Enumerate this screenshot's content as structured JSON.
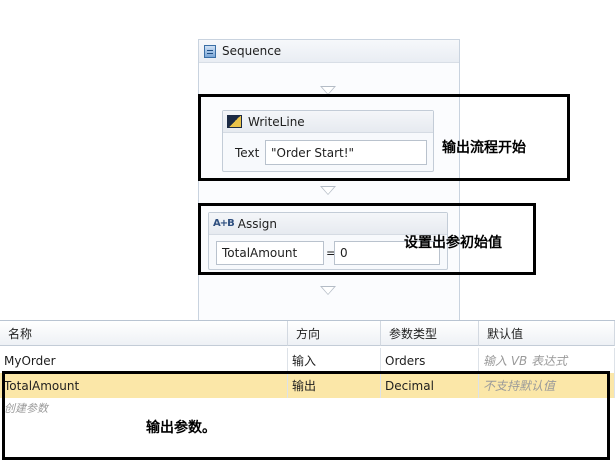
{
  "sequence": {
    "title": "Sequence"
  },
  "writeline": {
    "title": "WriteLine",
    "text_label": "Text",
    "text_value": "\"Order Start!\""
  },
  "assign": {
    "icon_text": "A+B",
    "title": "Assign",
    "to_value": "TotalAmount",
    "equals": "=",
    "value": "0"
  },
  "annotations": {
    "writeline_note": "输出流程开始",
    "assign_note": "设置出参初始值",
    "params_note": "输出参数。"
  },
  "grid": {
    "headers": [
      "名称",
      "方向",
      "参数类型",
      "默认值"
    ],
    "rows": [
      {
        "name": "MyOrder",
        "direction": "输入",
        "type": "Orders",
        "default": "输入 VB 表达式"
      },
      {
        "name": "TotalAmount",
        "direction": "输出",
        "type": "Decimal",
        "default": "不支持默认值"
      }
    ],
    "create_label": "创建参数"
  }
}
